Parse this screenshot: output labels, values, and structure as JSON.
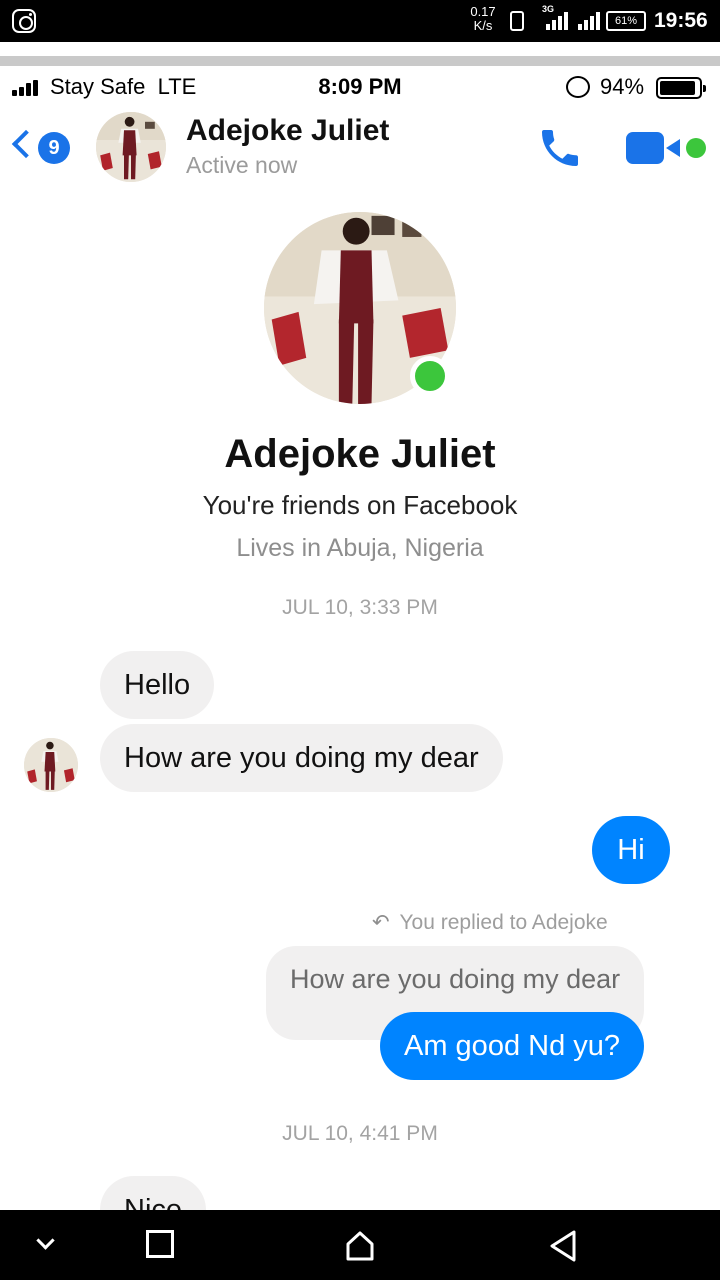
{
  "android_status": {
    "speed_value": "0.17",
    "speed_unit": "K/s",
    "network_type": "3G",
    "battery": "61%",
    "time": "19:56"
  },
  "ios_status": {
    "carrier": "Stay Safe",
    "network": "LTE",
    "time": "8:09 PM",
    "battery": "94%"
  },
  "header": {
    "back_count": "9",
    "name": "Adejoke Juliet",
    "status": "Active now"
  },
  "profile": {
    "name": "Adejoke Juliet",
    "friends_text": "You're friends on Facebook",
    "location_text": "Lives in Abuja, Nigeria"
  },
  "conversation": {
    "timestamp_1": "JUL 10, 3:33 PM",
    "incoming_1": "Hello",
    "incoming_2": "How are you doing my dear",
    "outgoing_1": "Hi",
    "replied_note": "You replied to Adejoke",
    "quoted_message": "How are you doing my dear",
    "outgoing_2": "Am good Nd yu?",
    "timestamp_2": "JUL 10, 4:41 PM",
    "incoming_3_partial": "Nice"
  },
  "colors": {
    "messenger_blue": "#0084ff",
    "accent_blue": "#1a73e8",
    "online_green": "#3cc63c",
    "bubble_gray": "#f1f0f0"
  },
  "icons": [
    "instagram-icon",
    "vibrate-icon",
    "signal-icon",
    "battery-icon",
    "back-chevron-icon",
    "phone-icon",
    "video-camera-icon",
    "reply-arrow-icon",
    "nav-down-icon",
    "nav-recents-icon",
    "nav-home-icon",
    "nav-back-icon"
  ]
}
